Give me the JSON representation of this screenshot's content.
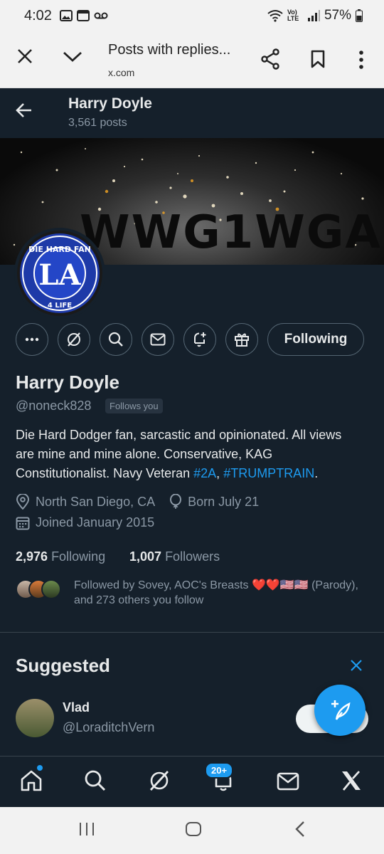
{
  "status_bar": {
    "time": "4:02",
    "battery": "57%",
    "network_label": "Vo) LTE"
  },
  "browser": {
    "page_title": "Posts with replies...",
    "url": "x.com"
  },
  "profile_header": {
    "name": "Harry Doyle",
    "posts_count": "3,561 posts"
  },
  "banner": {
    "text": "WWG1WGA"
  },
  "avatar": {
    "text_top": "DIE HARD FAN",
    "text_mid": "LA",
    "text_bottom": "4 LIFE"
  },
  "actions": {
    "following_label": "Following"
  },
  "profile": {
    "name": "Harry Doyle",
    "handle": "@noneck828",
    "follows_you": "Follows you",
    "bio_text": "Die Hard Dodger fan, sarcastic and opinionated. All views are mine and mine alone. Conservative, KAG Constitutionalist. Navy Veteran ",
    "bio_tag1": "#2A",
    "bio_sep": ", ",
    "bio_tag2": "#TRUMPTRAIN",
    "bio_end": ".",
    "location": "North San Diego, CA",
    "birthday": "Born July 21",
    "joined": "Joined January 2015",
    "following_count": "2,976",
    "following_label": "Following",
    "followers_count": "1,007",
    "followers_label": "Followers",
    "followed_by": "Followed by Sovey, AOC's Breasts ❤️❤️🇺🇸🇺🇸 (Parody), and 273 others you follow"
  },
  "suggested": {
    "title": "Suggested",
    "user_name": "Vlad",
    "user_handle": "@LoraditchVern"
  },
  "bottom_nav": {
    "notification_badge": "20+"
  },
  "colors": {
    "background": "#15202b",
    "accent": "#1d9bf0",
    "muted": "#8b98a5"
  }
}
